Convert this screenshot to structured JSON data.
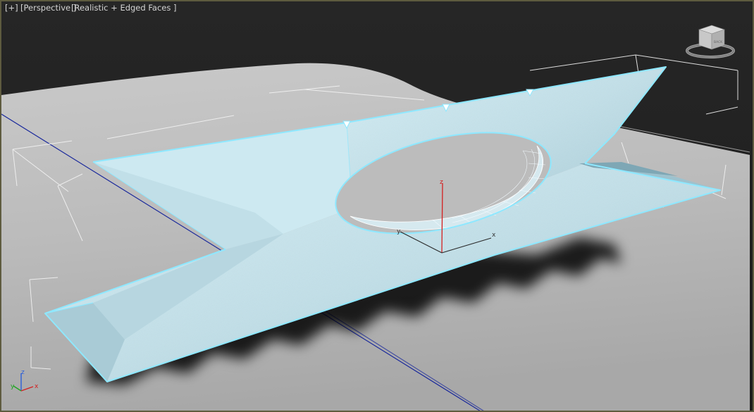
{
  "viewport": {
    "menu_label": "[+]",
    "view_label": "[Perspective ]",
    "shading_label": "[Realistic + Edged Faces ]"
  },
  "gizmo": {
    "z": "z",
    "x": "x",
    "y": "y"
  },
  "tripod": {
    "z": "z",
    "x": "x",
    "y": "y"
  },
  "viewcube": {
    "icon": "viewcube-icon",
    "face_label": "BACK"
  },
  "colors": {
    "background": "#1f1f1f",
    "ground": "#bdbdbd",
    "object": "#c5e3ec",
    "selection_edge": "#8ee8ff",
    "border": "#5e5b3f"
  }
}
